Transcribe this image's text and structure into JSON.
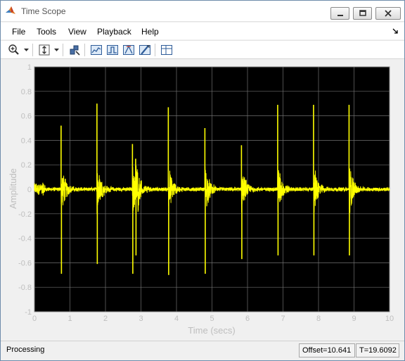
{
  "window": {
    "title": "Time Scope"
  },
  "menu": {
    "items": [
      "File",
      "Tools",
      "View",
      "Playback",
      "Help"
    ]
  },
  "toolbar": {
    "icons": [
      "zoom-in-icon",
      "dropdown-arrow-icon",
      "scale-axes-icon",
      "dropdown-arrow-icon",
      "highlight-simulink-icon",
      "signal-statistics-icon",
      "bilevel-measurements-icon",
      "peak-finder-icon",
      "cursor-measurements-icon",
      "configuration-properties-icon"
    ]
  },
  "status": {
    "text": "Processing",
    "offset": "Offset=10.641",
    "time": "T=19.6092"
  },
  "colors": {
    "axes_background": "#000000",
    "signal": "#ffff00",
    "grid": "#707070",
    "tick_text": "#bebebe"
  },
  "chart_data": {
    "type": "line",
    "title": "",
    "xlabel": "Time (secs)",
    "ylabel": "Amplitude",
    "xlim": [
      0,
      10
    ],
    "ylim": [
      -1,
      1
    ],
    "xticks": [
      "0",
      "1",
      "2",
      "3",
      "4",
      "5",
      "6",
      "7",
      "8",
      "9",
      "10"
    ],
    "yticks": [
      "-1",
      "-0.8",
      "-0.6",
      "-0.4",
      "-0.2",
      "0",
      "0.2",
      "0.4",
      "0.6",
      "0.8",
      "1"
    ],
    "grid": true,
    "legend": "none",
    "series": [
      {
        "color": "#ffff00",
        "impulses": [
          {
            "t": 0.75,
            "max": 0.52,
            "min": -0.69
          },
          {
            "t": 1.76,
            "max": 0.7,
            "min": -0.61
          },
          {
            "t": 2.76,
            "max": 0.37,
            "min": -0.69
          },
          {
            "t": 2.85,
            "max": 0.25,
            "min": -0.54
          },
          {
            "t": 3.77,
            "max": 0.67,
            "min": -0.7
          },
          {
            "t": 4.8,
            "max": 0.5,
            "min": -0.69
          },
          {
            "t": 5.83,
            "max": 0.36,
            "min": -0.57
          },
          {
            "t": 6.85,
            "max": 0.69,
            "min": -0.54
          },
          {
            "t": 7.86,
            "max": 0.69,
            "min": -0.54
          },
          {
            "t": 8.86,
            "max": 0.69,
            "min": -0.54
          }
        ]
      }
    ]
  }
}
